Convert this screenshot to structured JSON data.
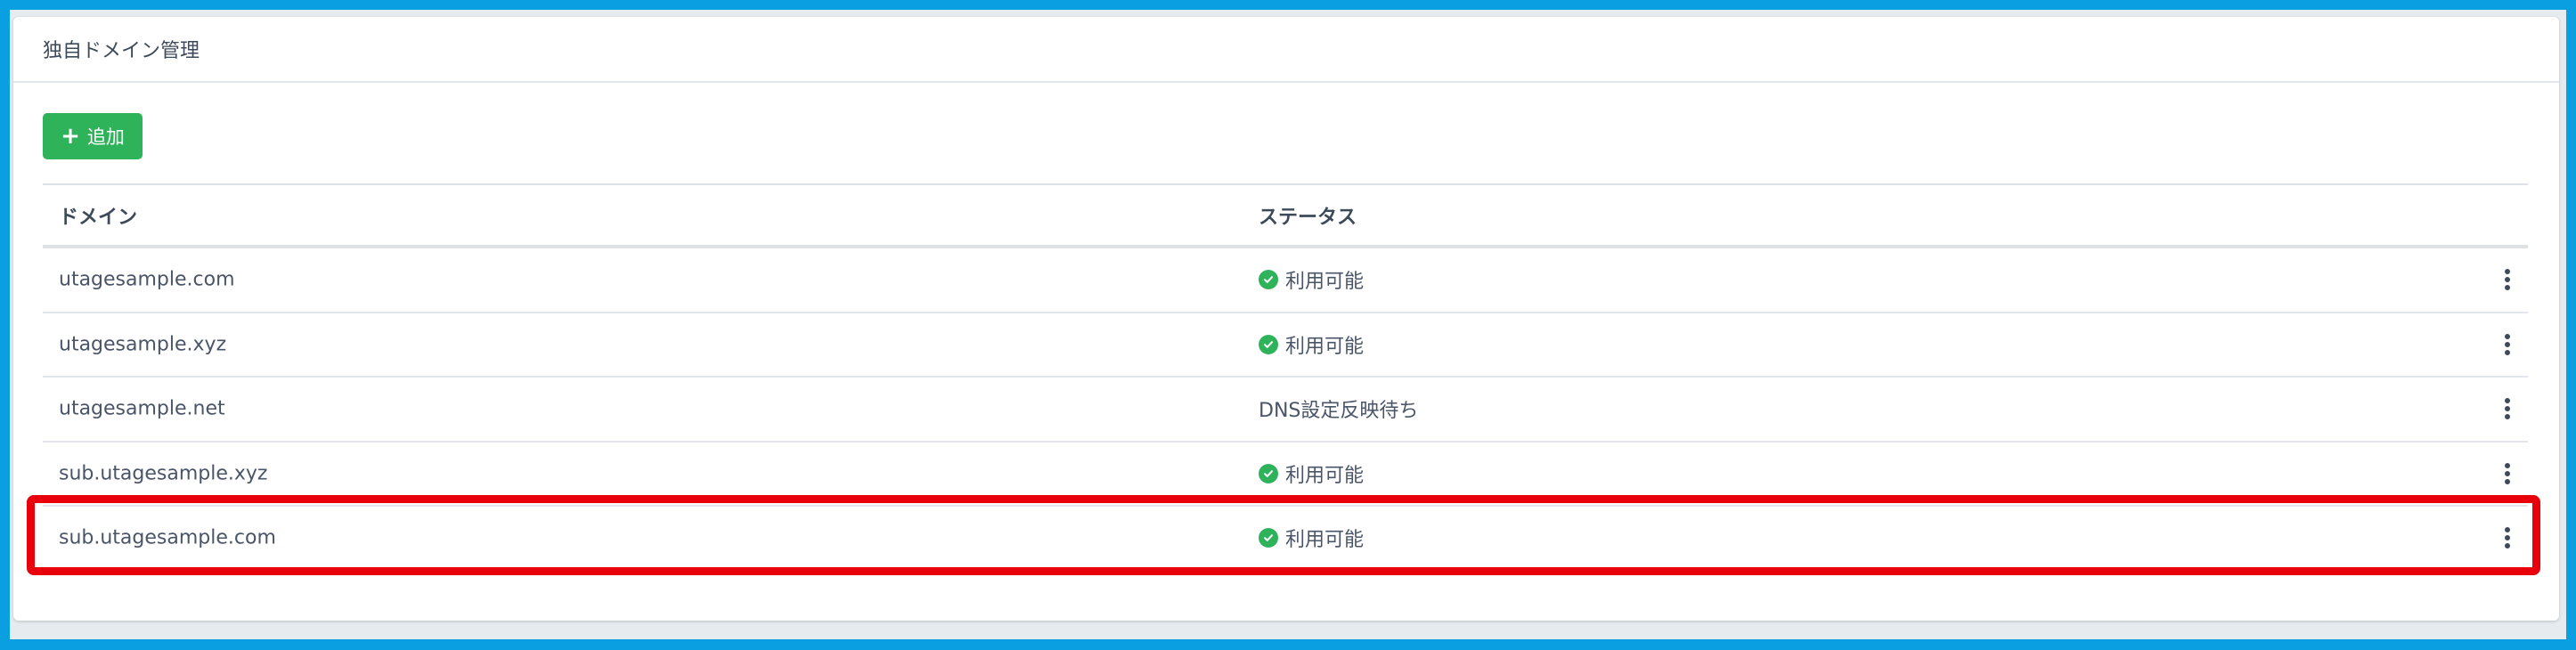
{
  "card": {
    "title": "独自ドメイン管理",
    "add_button_label": "追加"
  },
  "table": {
    "headers": {
      "domain": "ドメイン",
      "status": "ステータス"
    },
    "rows": [
      {
        "domain": "utagesample.com",
        "status": "利用可能",
        "available": true
      },
      {
        "domain": "utagesample.xyz",
        "status": "利用可能",
        "available": true
      },
      {
        "domain": "utagesample.net",
        "status": "DNS設定反映待ち",
        "available": false
      },
      {
        "domain": "sub.utagesample.xyz",
        "status": "利用可能",
        "available": true
      },
      {
        "domain": "sub.utagesample.com",
        "status": "利用可能",
        "available": true
      }
    ]
  },
  "colors": {
    "frame": "#0a9fe0",
    "accent_green": "#2fb35a",
    "highlight_red": "#e8000b"
  },
  "icons": {
    "add": "plus-icon",
    "available": "check-circle-icon",
    "row_menu": "vertical-ellipsis-icon"
  }
}
